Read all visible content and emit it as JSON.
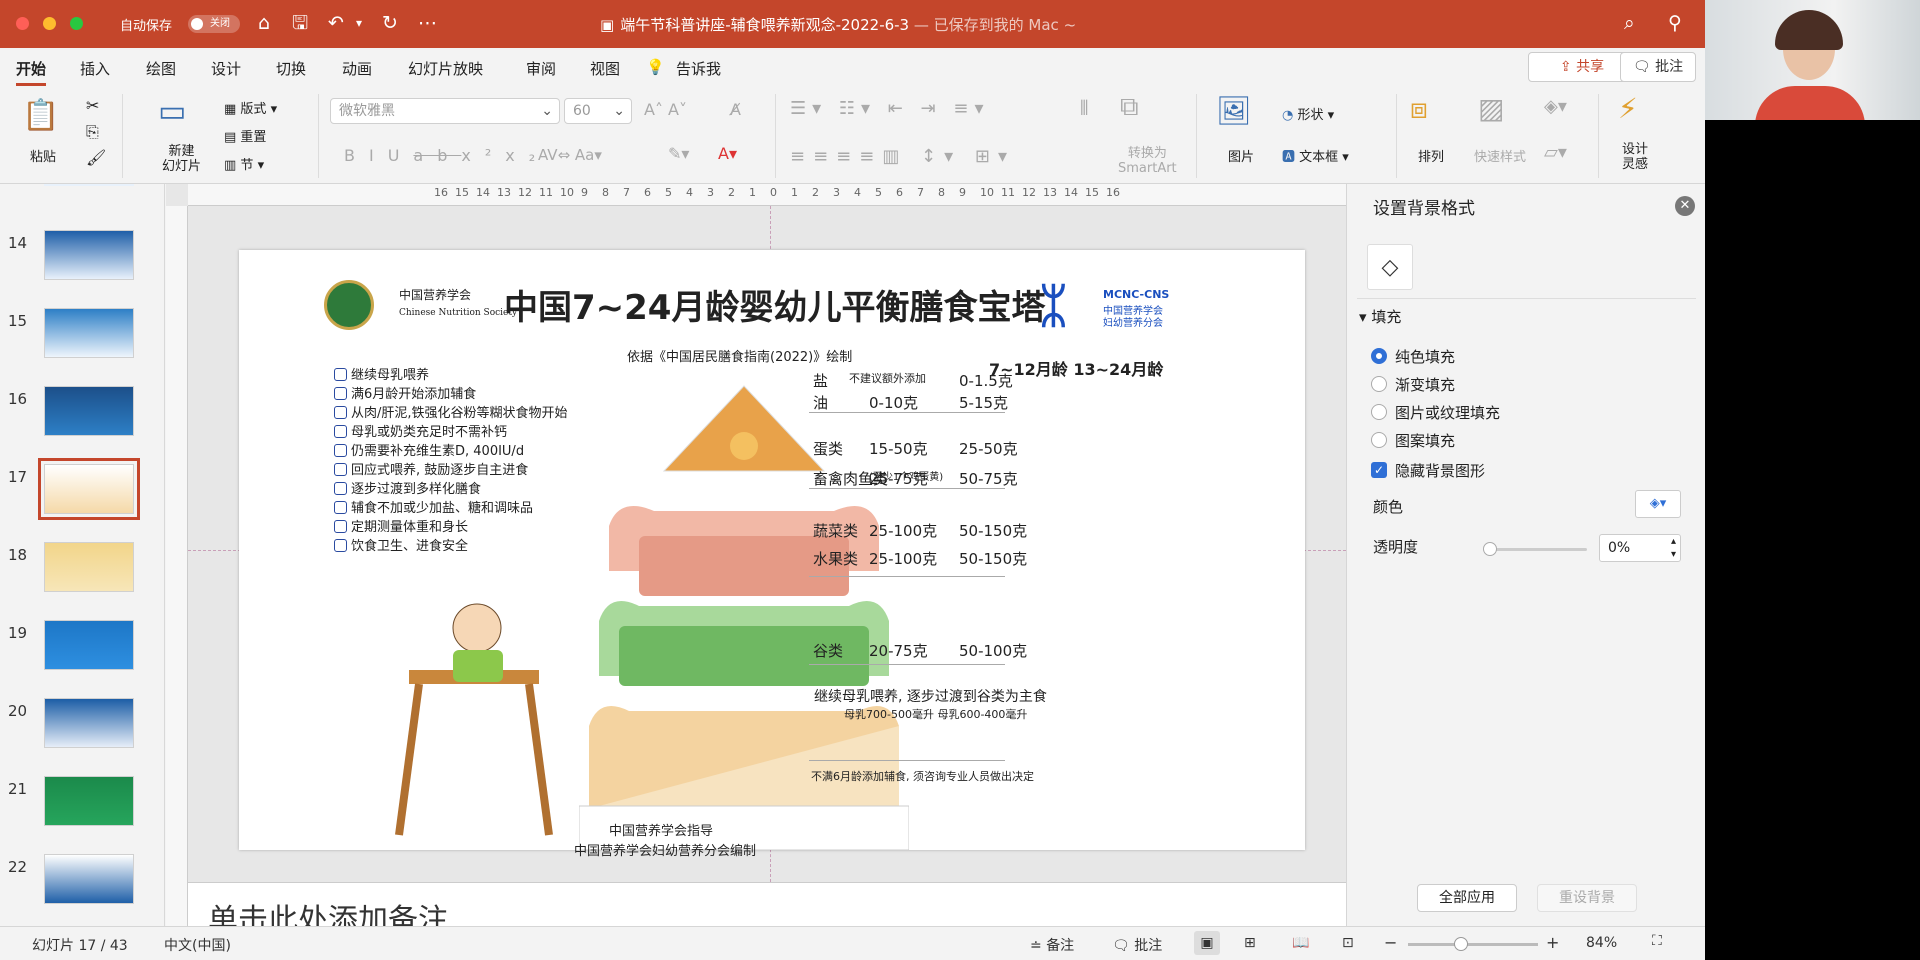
{
  "titlebar": {
    "autosave_label": "自动保存",
    "autosave_state": "关闭",
    "document_title": "端午节科普讲座-辅食喂养新观念-2022-6-3",
    "saved_status": " — 已保存到我的 Mac ~"
  },
  "menu": [
    "开始",
    "插入",
    "绘图",
    "设计",
    "切换",
    "动画",
    "幻灯片放映",
    "审阅",
    "视图",
    "告诉我"
  ],
  "share_label": "共享",
  "comment_label": "批注",
  "ribbon": {
    "paste": "粘贴",
    "new_slide": "新建\n幻灯片",
    "layout": "版式",
    "reset": "重置",
    "section": "节",
    "font_name": "微软雅黑",
    "font_size": "60",
    "convert_smartart": "转换为\nSmartArt",
    "picture": "图片",
    "shapes": "形状",
    "textbox": "文本框",
    "arrange": "排列",
    "quick_styles": "快速样式",
    "design_ideas": "设计\n灵感"
  },
  "thumbnails": [
    {
      "num": "14",
      "colors": [
        "#1f5fa8",
        "#e8f1fb"
      ]
    },
    {
      "num": "15",
      "colors": [
        "#2d7fc6",
        "#eef5fc"
      ]
    },
    {
      "num": "16",
      "colors": [
        "#1c4f8a",
        "#2d7fc6"
      ]
    },
    {
      "num": "17",
      "colors": [
        "#ffffff",
        "#f5d9a8"
      ]
    },
    {
      "num": "18",
      "colors": [
        "#f2d58a",
        "#f7e6b8"
      ]
    },
    {
      "num": "19",
      "colors": [
        "#1d77c7",
        "#2e8fe0"
      ]
    },
    {
      "num": "20",
      "colors": [
        "#1c5ea6",
        "#e6eef8"
      ]
    },
    {
      "num": "21",
      "colors": [
        "#1b8a4b",
        "#26a55c"
      ]
    },
    {
      "num": "22",
      "colors": [
        "#ffffff",
        "#1f5fa8"
      ]
    }
  ],
  "selected_slide": "17",
  "slide": {
    "society_cn": "中国营养学会",
    "society_en": "Chinese Nutrition Society",
    "title": "中国7~24月龄婴幼儿平衡膳食宝塔",
    "mcnc_label": "MCNC-CNS",
    "mcnc_line1": "中国营养学会",
    "mcnc_line2": "妇幼营养分会",
    "subtitle": "依据《中国居民膳食指南(2022)》绘制",
    "age_header": "7~12月龄  13~24月龄",
    "tips": [
      "继续母乳喂养",
      "满6月龄开始添加辅食",
      "从肉/肝泥,铁强化谷粉等糊状食物开始",
      "母乳或奶类充足时不需补钙",
      "仍需要补充维生素D, 400IU/d",
      "回应式喂养, 鼓励逐步自主进食",
      "逐步过渡到多样化膳食",
      "辅食不加或少加盐、糖和调味品",
      "定期测量体重和身长",
      "饮食卫生、进食安全"
    ],
    "rows": [
      {
        "name": "盐",
        "a": "不建议额外添加",
        "b": "0-1.5克"
      },
      {
        "name": "油",
        "a": "0-10克",
        "b": "5-15克"
      },
      {
        "name": "蛋类",
        "a": "15-50克",
        "b": "25-50克"
      },
      {
        "name": "畜禽肉鱼类",
        "a": "25-75克",
        "b": "50-75克"
      },
      {
        "name": "蔬菜类",
        "a": "25-100克",
        "b": "50-150克"
      },
      {
        "name": "水果类",
        "a": "25-100克",
        "b": "50-150克"
      },
      {
        "name": "谷类",
        "a": "20-75克",
        "b": "50-100克"
      }
    ],
    "egg_note": "(至少1个鸡蛋黄)",
    "breastfeeding": "继续母乳喂养, 逐步过渡到谷类为主食",
    "breastmilk": "母乳700-500毫升  母乳600-400毫升",
    "footnote": "不满6月龄添加辅食, 须咨询专业人员做出决定",
    "guide1": "中国营养学会指导",
    "guide2": "中国营养学会妇幼营养分会编制"
  },
  "notes_placeholder": "单击此处添加备注",
  "panel": {
    "title": "设置背景格式",
    "section": "填充",
    "options": [
      "纯色填充",
      "渐变填充",
      "图片或纹理填充",
      "图案填充"
    ],
    "selected_option": "纯色填充",
    "hide_bg_graphics": "隐藏背景图形",
    "hide_bg_checked": true,
    "color_label": "颜色",
    "transparency_label": "透明度",
    "transparency_value": "0%",
    "apply_all": "全部应用",
    "reset_bg": "重设背景"
  },
  "status": {
    "slide_counter": "幻灯片 17 / 43",
    "language": "中文(中国)",
    "notes": "备注",
    "comments": "批注",
    "zoom": "84%"
  },
  "colors": {
    "brand_red": "#c4462b",
    "selection_blue": "#2f6fd6",
    "roof_orange": "#e8a24a",
    "tier_pink": "#f2b8a6",
    "tier_green": "#8bc97d",
    "tier_yellow": "#f4d3a0"
  }
}
